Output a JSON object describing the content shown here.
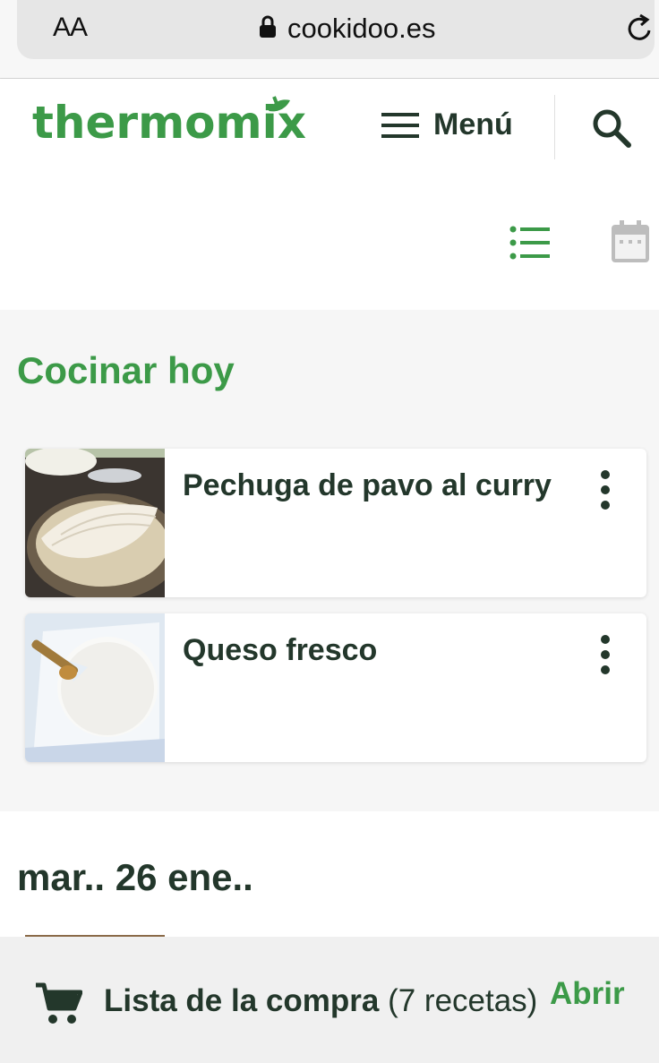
{
  "browser": {
    "text_size_label": "AA",
    "url": "cookidoo.es"
  },
  "header": {
    "logo_text": "thermomix",
    "menu_label": "Menú"
  },
  "today": {
    "title": "Cocinar hoy",
    "recipes": [
      {
        "title": "Pechuga de pavo al curry",
        "image": "turkey-breast-curry-photo"
      },
      {
        "title": "Queso fresco",
        "image": "fresh-cheese-photo"
      }
    ]
  },
  "date_section": {
    "title": "mar.. 26 ene.."
  },
  "shopping": {
    "label": "Lista de la compra",
    "count": "(7 recetas)",
    "open_label": "Abrir"
  },
  "colors": {
    "brand_green": "#3c9a48",
    "text_dark": "#23372b"
  }
}
